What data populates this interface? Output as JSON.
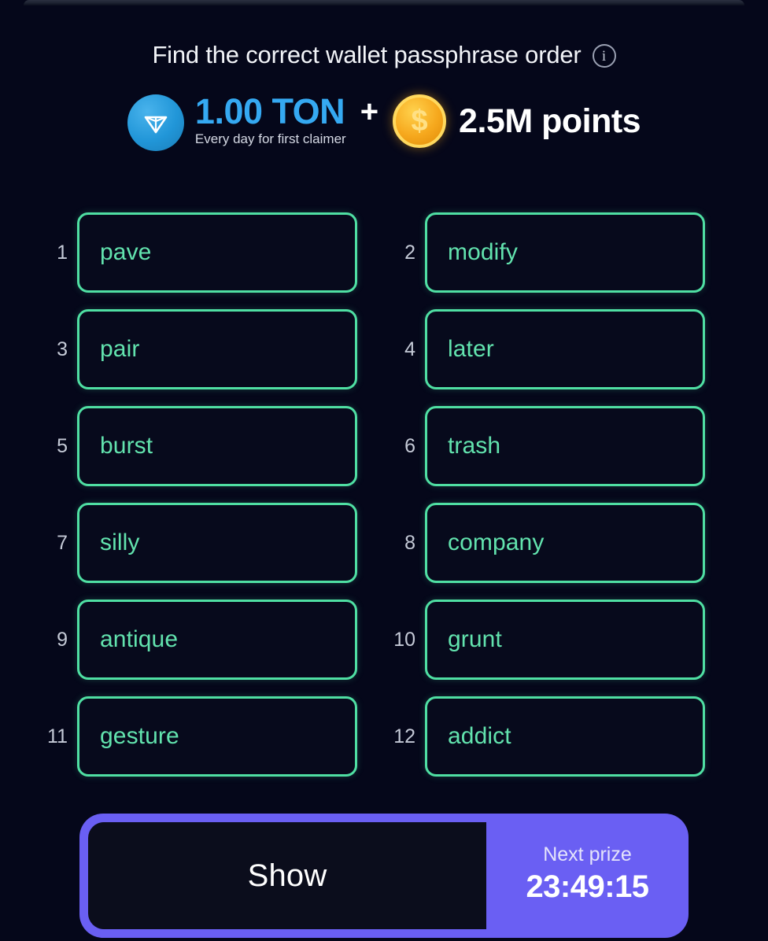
{
  "header": {
    "title": "Find the correct wallet passphrase order",
    "info_icon": "info-icon",
    "info_glyph": "i"
  },
  "prize": {
    "ton_icon": "ton-logo-icon",
    "ton_amount": "1.00 TON",
    "ton_subtitle": "Every day for first claimer",
    "separator": "+",
    "coin_icon": "coin-icon",
    "coin_glyph": "$",
    "points_amount": "2.5M points"
  },
  "grid": {
    "cells": [
      {
        "number": "1",
        "word": "pave"
      },
      {
        "number": "2",
        "word": "modify"
      },
      {
        "number": "3",
        "word": "pair"
      },
      {
        "number": "4",
        "word": "later"
      },
      {
        "number": "5",
        "word": "burst"
      },
      {
        "number": "6",
        "word": "trash"
      },
      {
        "number": "7",
        "word": "silly"
      },
      {
        "number": "8",
        "word": "company"
      },
      {
        "number": "9",
        "word": "antique"
      },
      {
        "number": "10",
        "word": "grunt"
      },
      {
        "number": "11",
        "word": "gesture"
      },
      {
        "number": "12",
        "word": "addict"
      }
    ]
  },
  "bottom": {
    "show_label": "Show",
    "next_prize_label": "Next prize",
    "next_prize_timer": "23:49:15"
  },
  "colors": {
    "background": "#05071a",
    "tile_border": "#4fdfa3",
    "tile_text": "#62e3ae",
    "accent_purple": "#6a5ff3",
    "ton_blue": "#35a9f2",
    "coin_orange": "#f6a81d",
    "number_gray": "#c5cad7"
  }
}
